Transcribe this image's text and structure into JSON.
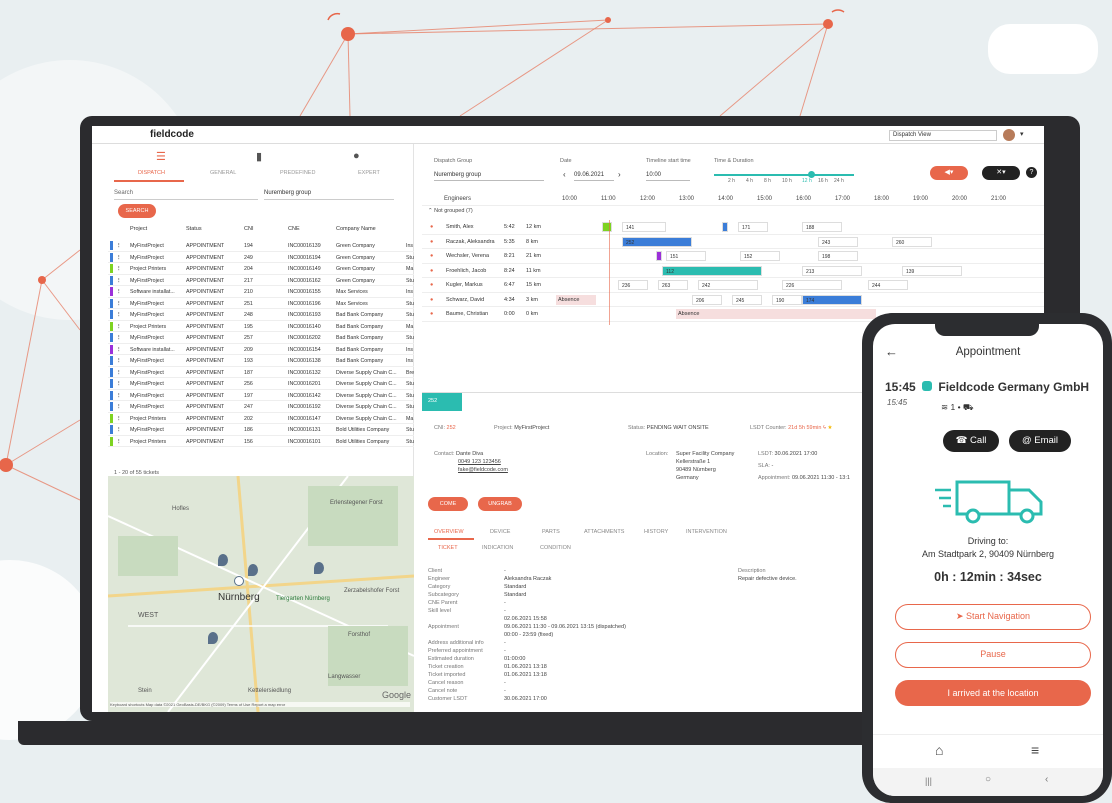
{
  "app": {
    "logo": "fieldcode",
    "view": "Dispatch View"
  },
  "left_panel": {
    "tabs": [
      "DISPATCH",
      "GENERAL",
      "PREDEFINED",
      "EXPERT"
    ],
    "search_placeholder": "Search",
    "group": "Nuremberg group",
    "search_button": "SEARCH",
    "columns": [
      "Project",
      "Status",
      "CNI",
      "CNE",
      "Company Name"
    ],
    "rows": [
      {
        "project": "MyFirstProject",
        "status": "APPOINTMENT",
        "cni": "194",
        "cne": "INC00016139",
        "company": "Green Company",
        "x": "Ins",
        "color": "#3b7dd8"
      },
      {
        "project": "MyFirstProject",
        "status": "APPOINTMENT",
        "cni": "249",
        "cne": "INC00016194",
        "company": "Green Company",
        "x": "Stu",
        "color": "#3b7dd8"
      },
      {
        "project": "Project Printers",
        "status": "APPOINTMENT",
        "cni": "204",
        "cne": "INC00016149",
        "company": "Green Company",
        "x": "Ma",
        "color": "#7ed321"
      },
      {
        "project": "MyFirstProject",
        "status": "APPOINTMENT",
        "cni": "217",
        "cne": "INC00016162",
        "company": "Green Company",
        "x": "Stu",
        "color": "#3b7dd8"
      },
      {
        "project": "Software installat...",
        "status": "APPOINTMENT",
        "cni": "210",
        "cne": "INC00016155",
        "company": "Max Services",
        "x": "Ins",
        "color": "#9b30d9"
      },
      {
        "project": "MyFirstProject",
        "status": "APPOINTMENT",
        "cni": "251",
        "cne": "INC00016196",
        "company": "Max Services",
        "x": "Stu",
        "color": "#3b7dd8"
      },
      {
        "project": "MyFirstProject",
        "status": "APPOINTMENT",
        "cni": "248",
        "cne": "INC00016193",
        "company": "Bad Bank Company",
        "x": "Stu",
        "color": "#3b7dd8"
      },
      {
        "project": "Project Printers",
        "status": "APPOINTMENT",
        "cni": "195",
        "cne": "INC00016140",
        "company": "Bad Bank Company",
        "x": "Ma",
        "color": "#7ed321"
      },
      {
        "project": "MyFirstProject",
        "status": "APPOINTMENT",
        "cni": "257",
        "cne": "INC00016202",
        "company": "Bad Bank Company",
        "x": "Stu",
        "color": "#3b7dd8"
      },
      {
        "project": "Software installat...",
        "status": "APPOINTMENT",
        "cni": "209",
        "cne": "INC00016154",
        "company": "Bad Bank Company",
        "x": "Ins",
        "color": "#9b30d9"
      },
      {
        "project": "MyFirstProject",
        "status": "APPOINTMENT",
        "cni": "193",
        "cne": "INC00016138",
        "company": "Bad Bank Company",
        "x": "Ins",
        "color": "#3b7dd8"
      },
      {
        "project": "MyFirstProject",
        "status": "APPOINTMENT",
        "cni": "187",
        "cne": "INC00016132",
        "company": "Diverse Supply Chain C...",
        "x": "Bre",
        "color": "#3b7dd8"
      },
      {
        "project": "MyFirstProject",
        "status": "APPOINTMENT",
        "cni": "256",
        "cne": "INC00016201",
        "company": "Diverse Supply Chain C...",
        "x": "Stu",
        "color": "#3b7dd8"
      },
      {
        "project": "MyFirstProject",
        "status": "APPOINTMENT",
        "cni": "197",
        "cne": "INC00016142",
        "company": "Diverse Supply Chain C...",
        "x": "Stu",
        "color": "#3b7dd8"
      },
      {
        "project": "MyFirstProject",
        "status": "APPOINTMENT",
        "cni": "247",
        "cne": "INC00016192",
        "company": "Diverse Supply Chain C...",
        "x": "Stu",
        "color": "#3b7dd8"
      },
      {
        "project": "Project Printers",
        "status": "APPOINTMENT",
        "cni": "202",
        "cne": "INC00016147",
        "company": "Diverse Supply Chain C...",
        "x": "Ma",
        "color": "#7ed321"
      },
      {
        "project": "MyFirstProject",
        "status": "APPOINTMENT",
        "cni": "186",
        "cne": "INC00016131",
        "company": "Bold Utilities Company",
        "x": "Stu",
        "color": "#3b7dd8"
      },
      {
        "project": "Project Printers",
        "status": "APPOINTMENT",
        "cni": "156",
        "cne": "INC00016101",
        "company": "Bold Utilities Company",
        "x": "Stu",
        "color": "#7ed321"
      }
    ],
    "footer": "1 - 20 of 55 tickets"
  },
  "map": {
    "labels": [
      "Hofles",
      "Erlenstegener Forst",
      "Nürnberg",
      "Tiergarten Nürnberg",
      "Zerzabelshofer Forst",
      "WEST",
      "Forsthof",
      "Langwasser",
      "Kettelersiedlung",
      "Stein",
      "Google"
    ],
    "footer": "Keyboard shortcuts   Map data ©2021 GeoBasis-DE/BKG (©2009)   Terms of Use   Report a map error"
  },
  "dispatch": {
    "group_label": "Dispatch Group",
    "group_value": "Nuremberg group",
    "date_label": "Date",
    "date_value": "09.06.2021",
    "timeline_label": "Timeline start time",
    "timeline_value": "10:00",
    "duration_label": "Time & Duration",
    "duration_ticks": [
      "2 h",
      "4 h",
      "8 h",
      "10 h",
      "12 h",
      "16 h",
      "24 h"
    ]
  },
  "gantt": {
    "col_engineers": "Engineers",
    "hours": [
      "10:00",
      "11:00",
      "12:00",
      "13:00",
      "14:00",
      "15:00",
      "16:00",
      "17:00",
      "18:00",
      "19:00",
      "20:00",
      "21:00"
    ],
    "group": "Not grouped (7)",
    "engineers": [
      {
        "name": "Smith, Alex",
        "time": "5:42",
        "km": "12 km"
      },
      {
        "name": "Raczak, Aleksandra",
        "time": "5:35",
        "km": "8 km"
      },
      {
        "name": "Wechsler, Verena",
        "time": "8:21",
        "km": "21 km"
      },
      {
        "name": "Froehlich, Jacob",
        "time": "8:24",
        "km": "11 km"
      },
      {
        "name": "Kugler, Markus",
        "time": "6:47",
        "km": "15 km"
      },
      {
        "name": "Schwarz, David",
        "time": "4:34",
        "km": "3 km"
      },
      {
        "name": "Baume, Christian",
        "time": "0:00",
        "km": "0 km"
      }
    ],
    "bar_labels": [
      "141",
      "171",
      "188",
      "252",
      "243",
      "260",
      "151",
      "152",
      "198",
      "112",
      "213",
      "139",
      "236",
      "263",
      "242",
      "226",
      "244",
      "206",
      "245",
      "190",
      "174"
    ],
    "absence": "Absence"
  },
  "detail": {
    "tab": "252",
    "cni_label": "CNI:",
    "cni_value": "252",
    "project_label": "Project:",
    "project_value": "MyFirstProject",
    "status_label": "Status:",
    "status_value": "PENDING WAIT ONSITE",
    "lsdt_label": "LSDT Counter:",
    "lsdt_value": "21d 5h 59min",
    "contact_label": "Contact:",
    "contact_name": "Dante Diva",
    "contact_phone": "0049 123 123456",
    "contact_email": "fake@fieldcode.com",
    "location_label": "Location:",
    "location_lines": [
      "Super Facility Company",
      "Kellerstraße 1",
      "90489 Nürnberg",
      "Germany"
    ],
    "lsdt2_label": "LSDT:",
    "lsdt2_value": "30.06.2021 17:00",
    "sla_label": "SLA:",
    "sla_value": "-",
    "appt_label": "Appointment:",
    "appt_value": "09.06.2021 11:30 - 13:1",
    "btn_come": "COME",
    "btn_unqrab": "UNGRAB",
    "tabs": [
      "OVERVIEW",
      "DEVICE",
      "PARTS",
      "ATTACHMENTS",
      "HISTORY",
      "INTERVENTION"
    ],
    "subtabs": [
      "TICKET",
      "INDICATION",
      "CONDITION"
    ],
    "fields": [
      [
        "Client",
        "-"
      ],
      [
        "Engineer",
        "Aleksandra Raczak"
      ],
      [
        "Category",
        "Standard"
      ],
      [
        "Subcategory",
        "Standard"
      ],
      [
        "CNE Parent",
        "-"
      ],
      [
        "Skill level",
        "-"
      ],
      [
        "",
        "02.06.2021 15:58"
      ],
      [
        "Appointment",
        "09.06.2021 11:30 - 09.06.2021 13:15 (dispatched)"
      ],
      [
        "",
        "00:00 - 23:59 (fixed)"
      ],
      [
        "Address additional info",
        "-"
      ],
      [
        "Preferred appointment",
        "-"
      ],
      [
        "Estimated duration",
        "01:00:00"
      ],
      [
        "Ticket creation",
        "01.06.2021 13:18"
      ],
      [
        "Ticket imported",
        "01.06.2021 13:18"
      ],
      [
        "Cancel reason",
        "-"
      ],
      [
        "Cancel note",
        "-"
      ],
      [
        "Customer LSDT",
        "30.06.2021 17:00"
      ]
    ],
    "desc_label": "Description",
    "desc_value": "Repair defective device."
  },
  "phone": {
    "title": "Appointment",
    "time": "15:45",
    "company": "Fieldcode Germany GmbH",
    "sub_time": "15:45",
    "sub_count": "1",
    "call": "Call",
    "email": "Email",
    "driving": "Driving to:",
    "address": "Am Stadtpark 2, 90409 Nürnberg",
    "timer": "0h : 12min : 34sec",
    "start_nav": "Start Navigation",
    "pause": "Pause",
    "arrived": "I arrived at the location"
  },
  "colors": {
    "accent": "#e8674b",
    "teal": "#2bbcb0",
    "blue": "#3b7dd8"
  }
}
